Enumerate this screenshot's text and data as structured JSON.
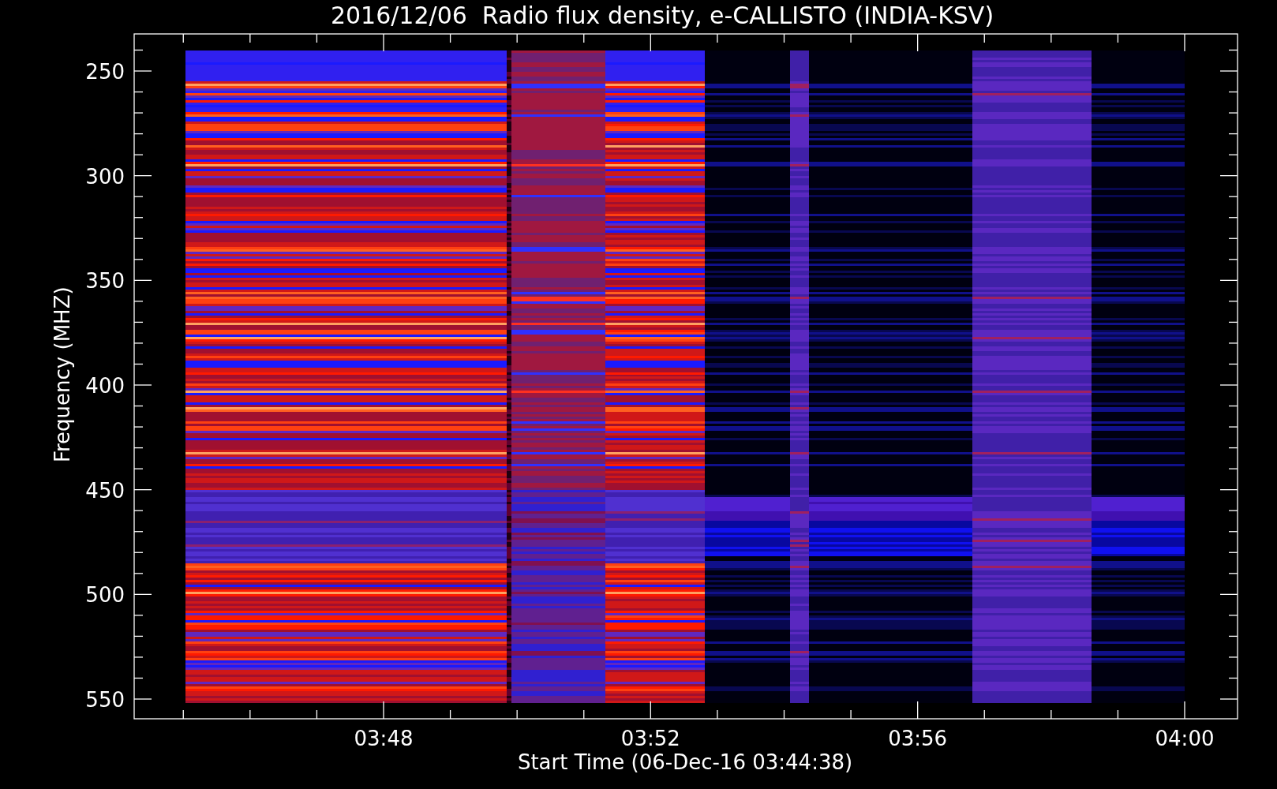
{
  "title": "2016/12/06  Radio flux density, e-CALLISTO (INDIA-KSV)",
  "y_axis": {
    "label": "Frequency (MHZ)",
    "ticks": [
      "250",
      "300",
      "350",
      "400",
      "450",
      "500",
      "550"
    ]
  },
  "x_axis": {
    "label": "Start Time (06-Dec-16 03:44:38)",
    "ticks": [
      "03:48",
      "03:52",
      "03:56",
      "04:00"
    ]
  }
}
